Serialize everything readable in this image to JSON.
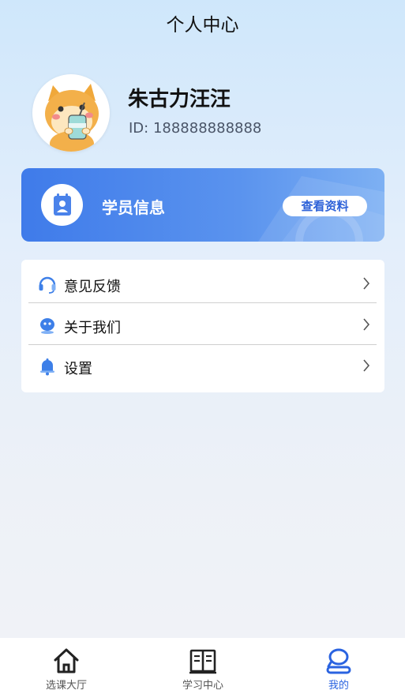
{
  "header": {
    "title": "个人中心"
  },
  "profile": {
    "name": "朱古力汪汪",
    "id_text": "ID: 188888888888"
  },
  "student_card": {
    "title": "学员信息",
    "button_label": "查看资料"
  },
  "menu": {
    "items": [
      {
        "label": "意见反馈",
        "icon": "headset-icon"
      },
      {
        "label": "关于我们",
        "icon": "robot-icon"
      },
      {
        "label": "设置",
        "icon": "bell-icon"
      }
    ]
  },
  "tabbar": {
    "tabs": [
      {
        "label": "选课大厅",
        "icon": "home-icon"
      },
      {
        "label": "学习中心",
        "icon": "book-icon"
      },
      {
        "label": "我的",
        "icon": "profile-icon"
      }
    ],
    "active_index": 2
  },
  "colors": {
    "accent": "#2a63e0",
    "card_blue": "#3f7bea",
    "background_top": "#cfe7fb"
  }
}
